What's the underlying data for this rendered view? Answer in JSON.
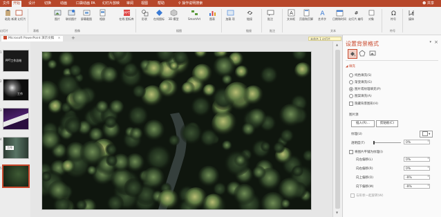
{
  "tabs": [
    "文件",
    "开始",
    "设计",
    "切换",
    "动画",
    "口袋动画 PA",
    "幻灯片放映",
    "审阅",
    "视图",
    "帮助"
  ],
  "active_tab_index": 1,
  "tell_me": "操作说明搜索",
  "user_label": "共享",
  "ribbon": {
    "buttons": [
      {
        "label": "粘贴",
        "icon": "paste-icon"
      },
      {
        "label": "新建 幻灯片",
        "icon": "new-slide-icon"
      },
      {
        "label": "图片",
        "icon": "picture-icon"
      },
      {
        "label": "联机图片",
        "icon": "online-picture-icon"
      },
      {
        "label": "屏幕截图",
        "icon": "screenshot-icon"
      },
      {
        "label": "相册",
        "icon": "album-icon"
      },
      {
        "label": "在线 图标库",
        "icon": "online-icons-icon"
      },
      {
        "label": "形状",
        "icon": "shapes-icon"
      },
      {
        "label": "在线图标",
        "icon": "icons-icon"
      },
      {
        "label": "3D 模型",
        "icon": "3d-model-icon"
      },
      {
        "label": "SmartArt",
        "icon": "smartart-icon"
      },
      {
        "label": "图表",
        "icon": "chart-icon"
      },
      {
        "label": "加载 项",
        "icon": "addins-icon"
      },
      {
        "label": "链接",
        "icon": "link-icon"
      },
      {
        "label": "批注",
        "icon": "comment-icon"
      },
      {
        "label": "文本框",
        "icon": "textbox-icon"
      },
      {
        "label": "页眉和页脚",
        "icon": "header-footer-icon"
      },
      {
        "label": "艺术字",
        "icon": "wordart-icon"
      },
      {
        "label": "日期和时间",
        "icon": "datetime-icon"
      },
      {
        "label": "幻灯片 编号",
        "icon": "slide-number-icon"
      },
      {
        "label": "对象",
        "icon": "object-icon"
      },
      {
        "label": "符号",
        "icon": "symbol-icon"
      },
      {
        "label": "媒体",
        "icon": "media-icon"
      }
    ],
    "groups": [
      "幻灯片",
      "表格",
      "图像",
      "插图",
      "链接",
      "批注",
      "文本",
      "符号"
    ]
  },
  "doc_tab": "Microsoft PowerPoint 演示文稿",
  "sticky_label": "未命名 1 幻灯片",
  "thumbnails": [
    {
      "num": "1",
      "text": "PPT工作总结"
    },
    {
      "num": "2",
      "text": "工作"
    },
    {
      "num": "3",
      "text": ""
    },
    {
      "num": "4",
      "text": "工作"
    },
    {
      "num": "5",
      "text": ""
    }
  ],
  "pane": {
    "title": "设置背景格式",
    "section": "填充",
    "options": [
      "纯色填充(S)",
      "渐变填充(G)",
      "图片或纹理填充(P)",
      "图案填充(A)",
      "隐藏背景图形(H)"
    ],
    "selected_option_index": 2,
    "picture_source_label": "图片源",
    "insert_btn": "插入(R)...",
    "clipboard_btn": "剪贴板(C)",
    "texture_label": "纹理(U)",
    "transparency_label": "透明度(T)",
    "transparency_value": "0%",
    "tile_label": "将图片平铺为纹理(I)",
    "offsets": [
      {
        "label": "向左偏移(L)",
        "value": "0%"
      },
      {
        "label": "向右偏移(R)",
        "value": "0%"
      },
      {
        "label": "向上偏移(O)",
        "value": "-9%"
      },
      {
        "label": "向下偏移(M)",
        "value": "-9%"
      }
    ],
    "rotate_label": "与形状一起旋转(W)"
  },
  "colors": {
    "accent": "#b7472a",
    "pane_accent": "#c9482c"
  }
}
